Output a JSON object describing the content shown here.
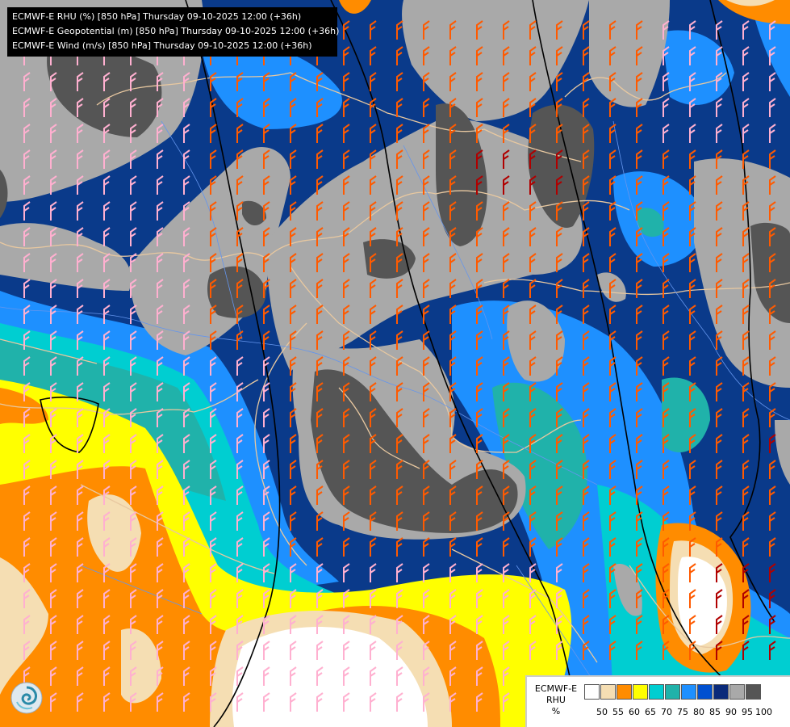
{
  "header": {
    "lines": [
      "ECMWF-E RHU (%) [850 hPa] Thursday 09-10-2025 12:00 (+36h)",
      "ECMWF-E Geopotential (m) [850 hPa] Thursday 09-10-2025 12:00 (+36h)",
      "ECMWF-E Wind (m/s) [850 hPa] Thursday 09-10-2025 12:00 (+36h)"
    ]
  },
  "legend": {
    "title_lines": [
      "ECMWF-E",
      "RHU",
      "%"
    ],
    "colors": [
      "#ffffff",
      "#f5deb3",
      "#ff8c00",
      "#ffff00",
      "#00ced1",
      "#20b2aa",
      "#1e90ff",
      "#0050d0",
      "#0a2a7a",
      "#a9a9a9",
      "#555555"
    ],
    "ticks": [
      "50",
      "55",
      "60",
      "65",
      "70",
      "75",
      "80",
      "85",
      "90",
      "95",
      "100"
    ]
  },
  "map": {
    "colors": {
      "white": "#ffffff",
      "wheat": "#f5deb3",
      "orange": "#ff8c00",
      "yellow": "#ffff00",
      "cyan": "#00ced1",
      "teal": "#20b2aa",
      "blue80": "#1e90ff",
      "blue85": "#0050d0",
      "navy": "#0a3a8a",
      "gray": "#a9a9a9",
      "darkgray": "#555555",
      "border": "#e8c8a0",
      "river": "#6495ed",
      "isoline": "#000000",
      "barb_orange": "#ff5a00",
      "barb_pink": "#ffb0d0",
      "barb_red": "#b00000"
    }
  }
}
